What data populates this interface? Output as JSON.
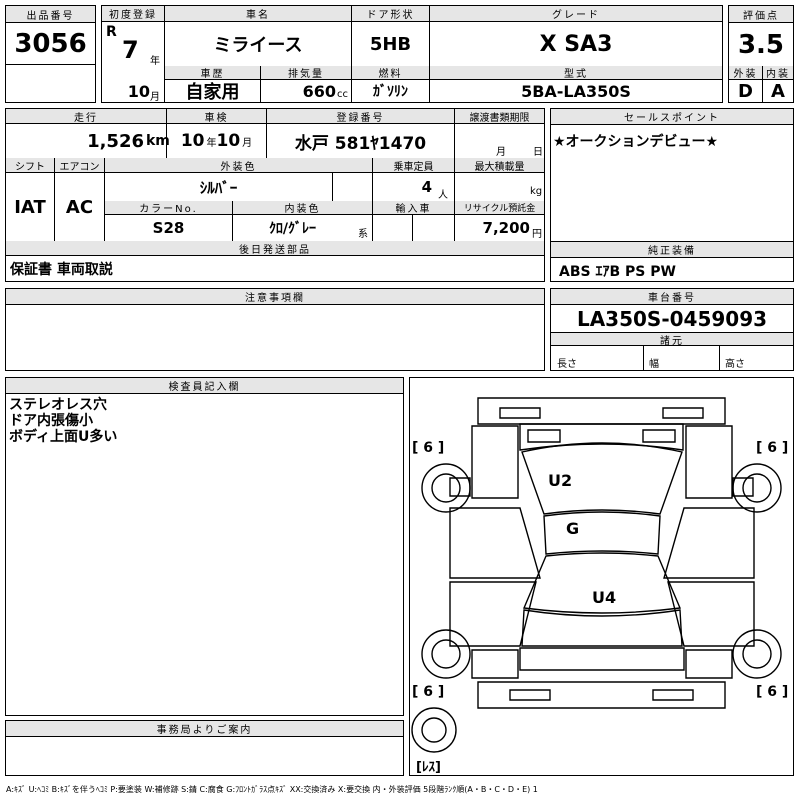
{
  "top": {
    "lot_no_label": "出品番号",
    "lot_no": "3056",
    "first_reg_label": "初度登録",
    "era": "R",
    "reg_year": "7",
    "year_unit": "年",
    "reg_month": "10",
    "month_unit": "月",
    "name_label": "車名",
    "name": "ミライース",
    "door_label": "ドア形状",
    "door": "5HB",
    "grade_label": "グレード",
    "grade": "X SA3",
    "score_label": "評価点",
    "score": "3.5",
    "history_label": "車歴",
    "history": "自家用",
    "displacement_label": "排気量",
    "displacement": "660",
    "displacement_unit": "cc",
    "fuel_label": "燃料",
    "fuel": "ｶﾞｿﾘﾝ",
    "model_label": "型式",
    "model": "5BA-LA350S",
    "ext_label": "外装",
    "ext": "D",
    "int_label": "内装",
    "int": "A"
  },
  "mid": {
    "mileage_label": "走行",
    "mileage": "1,526",
    "mileage_unit": "km",
    "inspection_label": "車検",
    "insp_year": "10",
    "insp_year_unit": "年",
    "insp_month": "10",
    "insp_month_unit": "月",
    "plate_label": "登録番号",
    "plate": "水戸 581ﾔ1470",
    "transfer_label": "譲渡書類期限",
    "transfer_month_unit": "月",
    "transfer_day_unit": "日",
    "shift_label": "シフト",
    "shift": "IAT",
    "ac_label": "エアコン",
    "ac": "AC",
    "color_label": "外装色",
    "color": "ｼﾙﾊﾞｰ",
    "capacity_label": "乗車定員",
    "capacity": "4",
    "capacity_unit": "人",
    "max_load_label": "最大積載量",
    "max_load_unit": "kg",
    "color_no_label": "カラーNo.",
    "color_no": "S28",
    "interior_color_label": "内装色",
    "interior_color": "ｸﾛ/ｸﾞﾚｰ",
    "interior_color_unit": "系",
    "import_label": "輸入車",
    "recycle_label": "リサイクル預託金",
    "recycle": "7,200",
    "recycle_unit": "円",
    "after_parts_label": "後日発送部品",
    "after_parts": "保証書 車両取説"
  },
  "side": {
    "sales_point_label": "セールスポイント",
    "sales_point": "★オークションデビュー★",
    "equipment_label": "純正装備",
    "equipment": "ABS ｴｱB PS PW",
    "chassis_label": "車台番号",
    "chassis": "LA350S-0459093",
    "dims_label": "諸元",
    "length_label": "長さ",
    "width_label": "幅",
    "height_label": "高さ"
  },
  "notes": {
    "label": "注意事項欄"
  },
  "inspector": {
    "label": "検査員記入欄",
    "lines": [
      "ステレオレス穴",
      "ドア内張傷小",
      "ボディ上面U多い"
    ]
  },
  "office": {
    "label": "事務局よりご案内"
  },
  "diagram": {
    "marks": {
      "u2": "U2",
      "g": "G",
      "u4": "U4"
    },
    "tires": {
      "fl": "[ 6 ]",
      "fr": "[ 6 ]",
      "rl": "[ 6 ]",
      "rr": "[ 6 ]"
    },
    "spare": "[ﾚｽ]"
  },
  "legend": "A:ｷｽﾞ U:ﾍｺﾐ B:ｷｽﾞを伴うﾍｺﾐ P:要塗装 W:補修跡 S:錆 C:腐食 G:ﾌﾛﾝﾄｶﾞﾗｽ点ｷｽﾞ XX:交換済み X:要交換 内・外装評価 5段階ﾗﾝｸ順(A・B・C・D・E) 1"
}
